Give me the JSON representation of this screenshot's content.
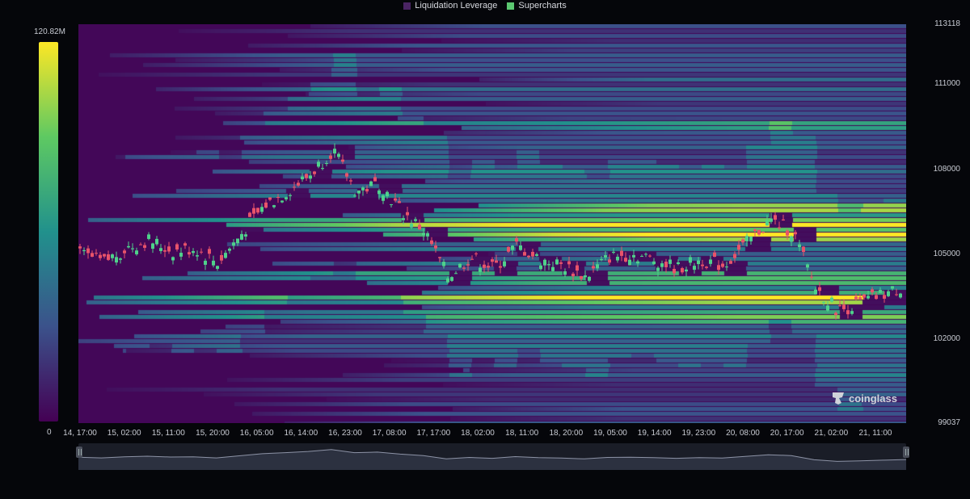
{
  "legend": {
    "items": [
      {
        "label": "Liquidation Leverage",
        "color": "#4a2463"
      },
      {
        "label": "Supercharts",
        "color": "#5bc871"
      }
    ]
  },
  "colorbar": {
    "max_label": "120.82M",
    "min_label": "0"
  },
  "brand": {
    "logo_text": "coinglass"
  },
  "chart_data": {
    "type": "heatmap",
    "title": "",
    "y_axis": {
      "ticks": [
        "113118",
        "111000",
        "108000",
        "105000",
        "102000",
        "99037"
      ],
      "range": [
        99037,
        113118
      ]
    },
    "x_axis": {
      "ticks": [
        "14, 17:00",
        "15, 02:00",
        "15, 11:00",
        "15, 20:00",
        "16, 05:00",
        "16, 14:00",
        "16, 23:00",
        "17, 08:00",
        "17, 17:00",
        "18, 02:00",
        "18, 11:00",
        "18, 20:00",
        "19, 05:00",
        "19, 14:00",
        "19, 23:00",
        "20, 08:00",
        "20, 17:00",
        "21, 02:00",
        "21, 11:00"
      ]
    },
    "colorbar_range": [
      0,
      120.82
    ],
    "colorscale": [
      "#440154",
      "#3b528b",
      "#21918c",
      "#5ec962",
      "#fde725"
    ],
    "price_series": [
      {
        "t": 0,
        "price": 105000
      },
      {
        "t": 1,
        "price": 104700
      },
      {
        "t": 2,
        "price": 105200
      },
      {
        "t": 3,
        "price": 105500
      },
      {
        "t": 4,
        "price": 105100
      },
      {
        "t": 5,
        "price": 105200
      },
      {
        "t": 6,
        "price": 104700
      },
      {
        "t": 7,
        "price": 105700
      },
      {
        "t": 8,
        "price": 106700
      },
      {
        "t": 9,
        "price": 107200
      },
      {
        "t": 10,
        "price": 107800
      },
      {
        "t": 11,
        "price": 108700
      },
      {
        "t": 12,
        "price": 107200
      },
      {
        "t": 13,
        "price": 107500
      },
      {
        "t": 14,
        "price": 106500
      },
      {
        "t": 15,
        "price": 105800
      },
      {
        "t": 16,
        "price": 104200
      },
      {
        "t": 17,
        "price": 104900
      },
      {
        "t": 18,
        "price": 104500
      },
      {
        "t": 19,
        "price": 105300
      },
      {
        "t": 20,
        "price": 104800
      },
      {
        "t": 21,
        "price": 104600
      },
      {
        "t": 22,
        "price": 104200
      },
      {
        "t": 23,
        "price": 104900
      },
      {
        "t": 24,
        "price": 105000
      },
      {
        "t": 25,
        "price": 104800
      },
      {
        "t": 26,
        "price": 104500
      },
      {
        "t": 27,
        "price": 104800
      },
      {
        "t": 28,
        "price": 104600
      },
      {
        "t": 29,
        "price": 105400
      },
      {
        "t": 30,
        "price": 106200
      },
      {
        "t": 31,
        "price": 105800
      },
      {
        "t": 32,
        "price": 103800
      },
      {
        "t": 33,
        "price": 103000
      },
      {
        "t": 34,
        "price": 103300
      },
      {
        "t": 35,
        "price": 103600
      },
      {
        "t": 36,
        "price": 103900
      }
    ],
    "hot_bands": [
      {
        "price": 103500,
        "intensity": 1.0
      },
      {
        "price": 106100,
        "intensity": 0.9
      },
      {
        "price": 105700,
        "intensity": 0.8
      },
      {
        "price": 109600,
        "intensity": 0.55
      },
      {
        "price": 106700,
        "intensity": 0.5
      },
      {
        "price": 102800,
        "intensity": 0.5
      },
      {
        "price": 104200,
        "intensity": 0.45
      }
    ]
  }
}
